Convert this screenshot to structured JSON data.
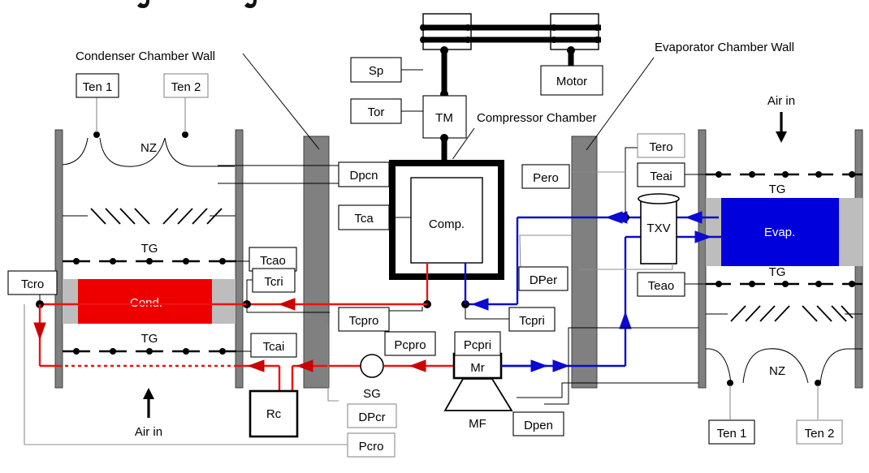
{
  "diagram": {
    "title_cut": "",
    "annotations": [
      {
        "id": "condenser-chamber-wall",
        "text": "Condenser Chamber Wall"
      },
      {
        "id": "compressor-chamber",
        "text": "Compressor Chamber"
      },
      {
        "id": "evaporator-chamber-wall",
        "text": "Evaporator Chamber Wall"
      }
    ],
    "components": {
      "cond": "Cond.",
      "evap": "Evap.",
      "comp": "Comp.",
      "tm": "TM",
      "motor": "Motor",
      "txv": "TXV",
      "rc": "Rc",
      "mr": "Mr",
      "mf": "MF",
      "sg": "SG"
    },
    "zone_labels": {
      "nz_left": "NZ",
      "nz_right": "NZ",
      "tg_cond_top": "TG",
      "tg_cond_bottom": "TG",
      "tg_evap_top": "TG",
      "tg_evap_bottom": "TG"
    },
    "air_labels": {
      "left": "Air in",
      "right": "Air in"
    },
    "sensors": {
      "ten1_left": "Ten 1",
      "ten2_left": "Ten 2",
      "ten1_right": "Ten 1",
      "ten2_right": "Ten 2",
      "tcro": "Tcro",
      "tcao": "Tcao",
      "tcri": "Tcri",
      "tcai": "Tcai",
      "dpcn": "Dpcn",
      "tca": "Tca",
      "sp": "Sp",
      "tor": "Tor",
      "tcpro": "Tcpro",
      "pcpro": "Pcpro",
      "tcpri": "Tcpri",
      "pcpri": "Pcpri",
      "dpcr": "DPcr",
      "pcro": "Pcro",
      "pero": "Pero",
      "tero": "Tero",
      "teai": "Teai",
      "dper": "DPer",
      "teao": "Teao",
      "dpen": "Dpen"
    },
    "colors": {
      "condenser": "#ee0000",
      "evaporator": "#0000dd",
      "refrigerant_high": "#ee1111",
      "refrigerant_low": "#0a0ad0",
      "wall": "#808080",
      "coil_surround": "#bdbdbd"
    }
  }
}
